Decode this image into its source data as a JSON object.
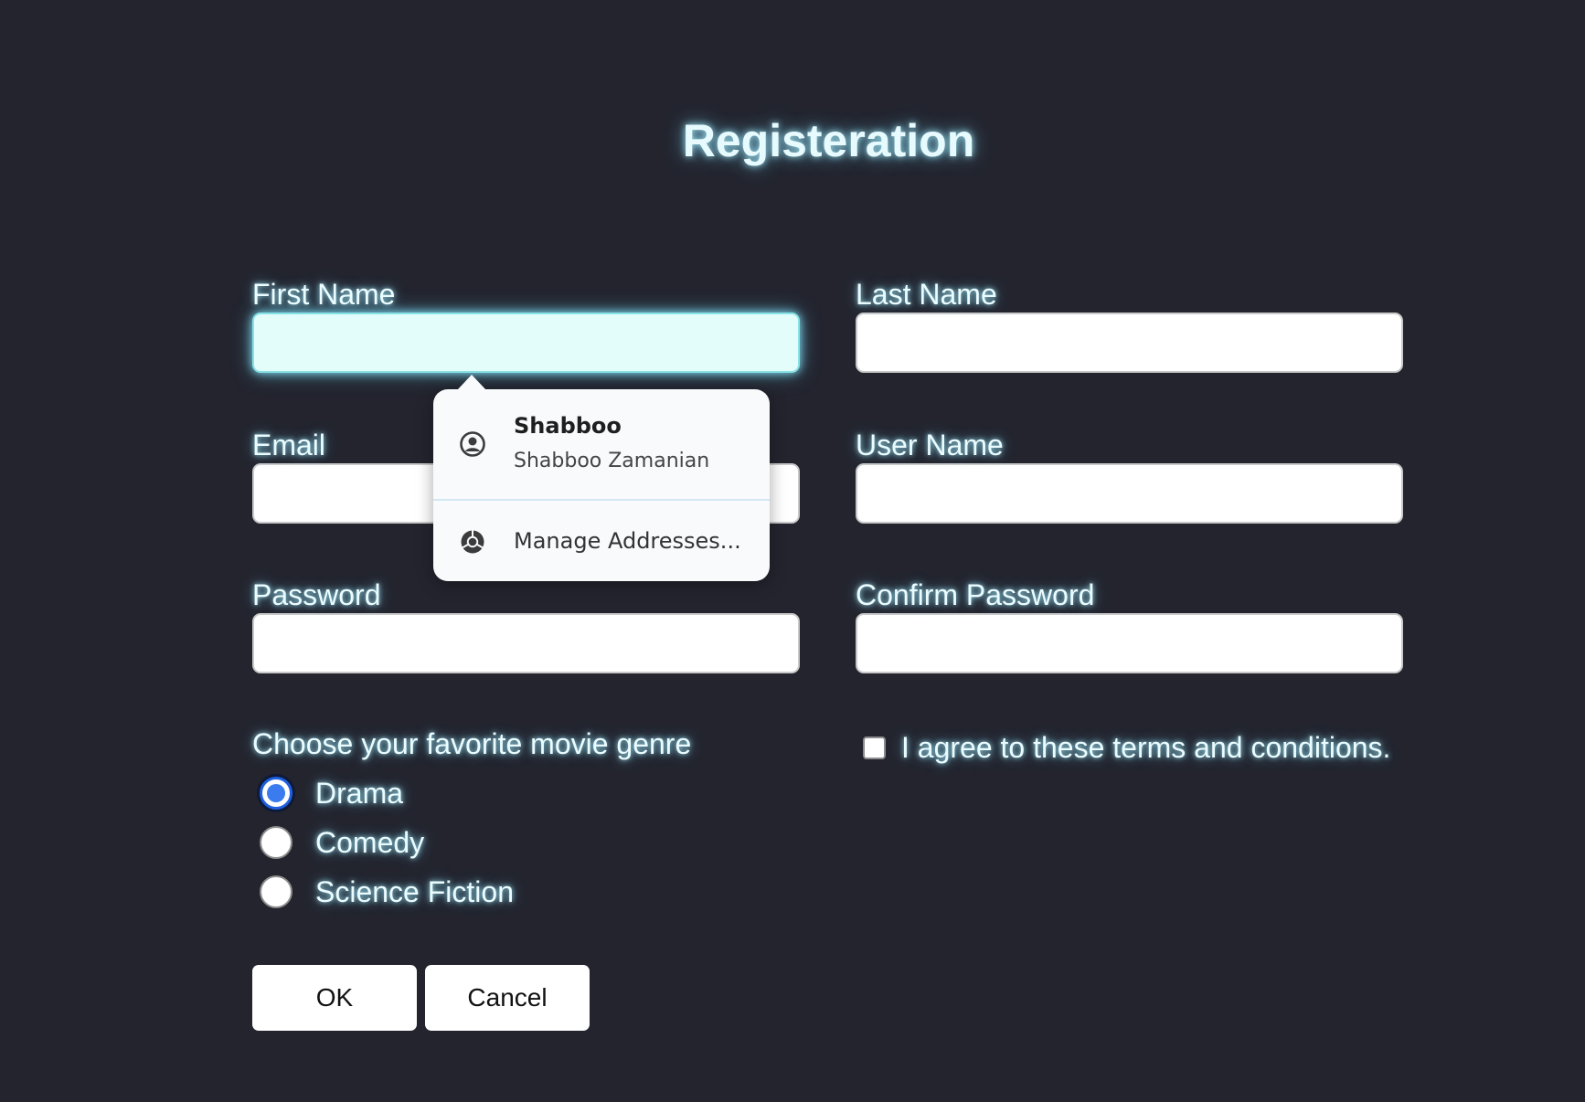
{
  "page": {
    "title": "Registeration"
  },
  "form": {
    "first_name": {
      "label": "First Name",
      "value": ""
    },
    "last_name": {
      "label": "Last Name",
      "value": ""
    },
    "email": {
      "label": "Email",
      "value": ""
    },
    "user_name": {
      "label": "User Name",
      "value": ""
    },
    "password": {
      "label": "Password",
      "value": ""
    },
    "confirm_password": {
      "label": "Confirm Password",
      "value": ""
    },
    "genre": {
      "label": "Choose your favorite movie genre",
      "options": [
        "Drama",
        "Comedy",
        "Science Fiction"
      ],
      "selected": "Drama"
    },
    "terms": {
      "label": "I agree to these terms and conditions.",
      "checked": false
    },
    "buttons": {
      "ok": "OK",
      "cancel": "Cancel"
    }
  },
  "autofill": {
    "suggestion": {
      "title": "Shabboo",
      "subtitle": "Shabboo Zamanian",
      "icon": "account-circle-icon"
    },
    "manage": {
      "label": "Manage Addresses...",
      "icon": "chrome-icon"
    }
  },
  "colors": {
    "background": "#23242e",
    "text_glow": "#aaf0ff",
    "focused_input": "#e3fdfb",
    "radio_accent": "#3a7bf0"
  }
}
